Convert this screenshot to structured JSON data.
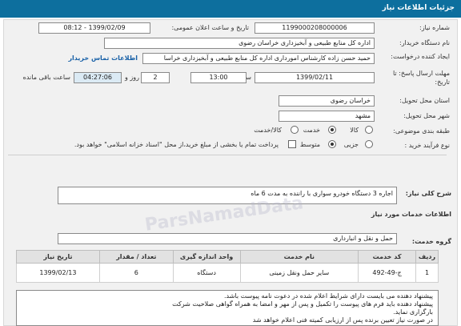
{
  "header": {
    "title": "جزئیات اطلاعات نیاز"
  },
  "labels": {
    "need_number": "شماره نیاز:",
    "announce_datetime": "تاریخ و ساعت اعلان عمومی:",
    "buyer_name": "نام دستگاه خریدار:",
    "requester": "ایجاد کننده درخواست:",
    "contact_link": "اطلاعات تماس خریدار",
    "reply_deadline": "مهلت ارسال پاسخ: تا تاریخ:",
    "time_word": "ساعت",
    "day_word": "روز و",
    "remaining": "ساعت باقی مانده",
    "province": "استان محل تحویل:",
    "city": "شهر محل تحویل:",
    "category": "طبقه بندی موضوعی:",
    "process_type": "نوع فرآیند خرید :",
    "need_summary": "شرح کلی نیاز:",
    "services_info": "اطلاعات خدمات مورد نیاز",
    "service_group": "گروه خدمت:"
  },
  "values": {
    "need_number": "1199000208000006",
    "announce_datetime": "1399/02/09 - 08:12",
    "buyer_name": "اداره کل منابع طبیعی و آبخیزداری خراسان رضوی",
    "requester": "حمید حسن زاده  کارشناس امورداری اداره کل منابع طبیعی و آبخیزداری خراسا",
    "reply_date": "1399/02/11",
    "reply_time": "13:00",
    "days": "2",
    "remaining_time": "04:27:06",
    "province": "خراسان رضوی",
    "city": "مشهد",
    "need_summary": "اجاره 3 دستگاه خودرو سواری با راننده به مدت 6 ماه",
    "service_group": "حمل و نقل و انبارداری"
  },
  "category_options": [
    "کالا",
    "خدمت",
    "کالا/خدمت"
  ],
  "process_options": [
    "جزیی",
    "متوسط"
  ],
  "payment_note": "پرداخت تمام یا بخشی از مبلغ خرید،از محل \"اسناد خزانه اسلامی\" خواهد بود.",
  "table": {
    "headers": [
      "ردیف",
      "کد خدمت",
      "نام خدمت",
      "واحد اندازه گیری",
      "تعداد / مقدار",
      "تاریخ نیاز"
    ],
    "rows": [
      [
        "1",
        "ج-49-492",
        "سایر حمل ونقل زمینی",
        "دستگاه",
        "6",
        "1399/02/13"
      ]
    ]
  },
  "notes": [
    "پیشنهاد دهنده می بایست دارای شرایط اعلام شده در دعوت نامه پیوست باشد.",
    "پیشنهاد دهنده باید فرم های پیوست را تکمیل و پس از مهر و امضا به همراه گواهی صلاحیت شرکت",
    "بارگزاری نماید.",
    "در صورت نیاز تعیین برنده پس از ارزیابی کمیته فنی اعلام خواهد شد"
  ],
  "watermark": "ParsNamadData"
}
